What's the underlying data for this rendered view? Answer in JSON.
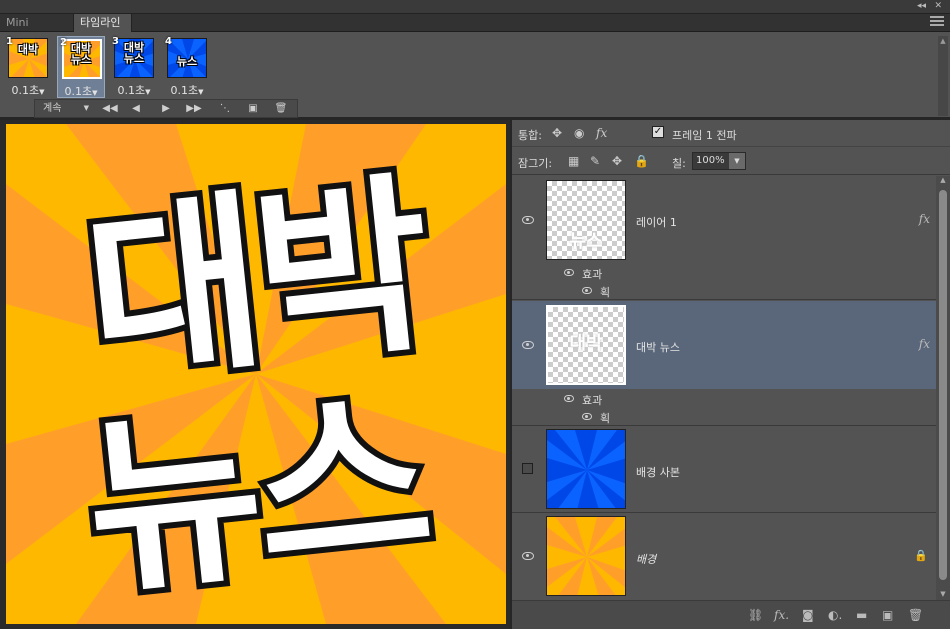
{
  "tabs": [
    {
      "label": "Mini Bridge",
      "active": false
    },
    {
      "label": "타임라인",
      "active": true
    }
  ],
  "timeline": {
    "frames": [
      {
        "number": "1",
        "thumb_text": "대박",
        "delay": "0.1초",
        "bg": "orange",
        "selected": false
      },
      {
        "number": "2",
        "thumb_text": "대박\n뉴스",
        "delay": "0.1초",
        "bg": "orange",
        "selected": true
      },
      {
        "number": "3",
        "thumb_text": "대박\n뉴스",
        "delay": "0.1초",
        "bg": "blue",
        "selected": false
      },
      {
        "number": "4",
        "thumb_text": "뉴스",
        "delay": "0.1초",
        "bg": "blue",
        "selected": false
      }
    ],
    "loop_label": "계속"
  },
  "canvas": {
    "line1": "대박",
    "line2": "뉴스"
  },
  "layers_panel": {
    "unify_label": "통합:",
    "propagate_label": "프레임 1 전파",
    "lock_label": "잠그기:",
    "fill_label": "칠:",
    "fill_value": "100%",
    "layers": [
      {
        "name": "레이어 1",
        "thumb_text": "뉴스",
        "effects": "효과",
        "effect_item": "획",
        "fx": "fx",
        "visible": true
      },
      {
        "name": "대박 뉴스",
        "thumb_text": "대박",
        "effects": "효과",
        "effect_item": "획",
        "fx": "fx",
        "visible": true,
        "selected": true
      },
      {
        "name": "배경 사본",
        "visible": false
      },
      {
        "name": "배경",
        "visible": true,
        "locked": true
      }
    ]
  },
  "colors": {
    "orange_bg": "#ffb800",
    "orange_ray": "#ff9f2a",
    "blue_bg": "#0047e8",
    "blue_ray": "#0a63ff",
    "selection": "#5a6679",
    "panel": "#535353"
  }
}
